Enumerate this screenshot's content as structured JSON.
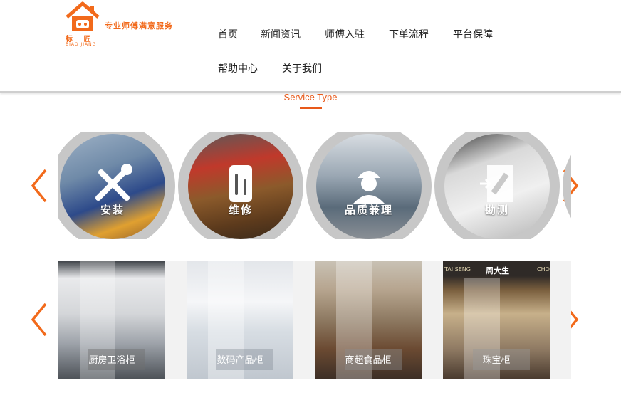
{
  "logo": {
    "slogan": "专业师傅满意服务",
    "brand": "标 匠",
    "brand_en": "BIAO JIANG"
  },
  "nav": {
    "items": [
      "首页",
      "新闻资讯",
      "师傅入驻",
      "下单流程",
      "平台保障",
      "帮助中心",
      "关于我们"
    ]
  },
  "section": {
    "title": "Service Type"
  },
  "services": [
    {
      "label": "安装",
      "icon": "tools-icon"
    },
    {
      "label": "维修",
      "icon": "phone-repair-icon"
    },
    {
      "label": "品质兼理",
      "icon": "worker-icon"
    },
    {
      "label": "勘测",
      "icon": "ruler-document-icon"
    }
  ],
  "cabinets": [
    {
      "label": "厨房卫浴柜"
    },
    {
      "label": "数码产品柜"
    },
    {
      "label": "商超食品柜"
    },
    {
      "label": "珠宝柜"
    }
  ],
  "jewelry_sign": {
    "left": "TAI SENG",
    "center": "周大生",
    "right": "CHO"
  },
  "colors": {
    "accent": "#e8591a",
    "arrow": "#f26a1b"
  }
}
